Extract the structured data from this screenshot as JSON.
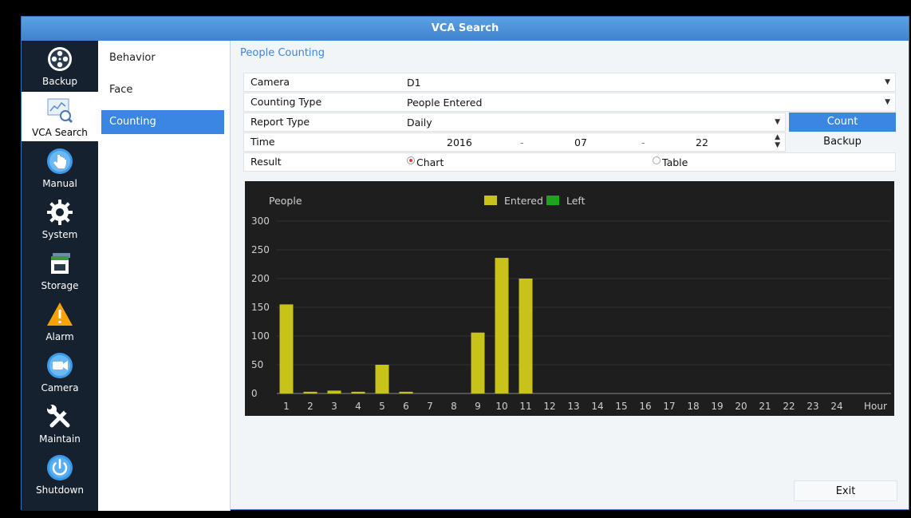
{
  "window": {
    "title": "VCA Search"
  },
  "nav": [
    {
      "id": "backup",
      "label": "Backup",
      "icon": "film-reel-icon"
    },
    {
      "id": "vca-search",
      "label": "VCA Search",
      "icon": "chart-magnifier-icon",
      "active": true
    },
    {
      "id": "manual",
      "label": "Manual",
      "icon": "hand-pointer-icon"
    },
    {
      "id": "system",
      "label": "System",
      "icon": "gear-icon"
    },
    {
      "id": "storage",
      "label": "Storage",
      "icon": "storage-icon"
    },
    {
      "id": "alarm",
      "label": "Alarm",
      "icon": "warning-icon"
    },
    {
      "id": "camera",
      "label": "Camera",
      "icon": "camera-icon"
    },
    {
      "id": "maintain",
      "label": "Maintain",
      "icon": "wrench-screwdriver-icon"
    },
    {
      "id": "shutdown",
      "label": "Shutdown",
      "icon": "power-icon"
    }
  ],
  "subnav": [
    {
      "label": "Behavior"
    },
    {
      "label": "Face"
    },
    {
      "label": "Counting",
      "active": true
    }
  ],
  "section_title": "People Counting",
  "form": {
    "camera_label": "Camera",
    "camera_value": "D1",
    "counting_type_label": "Counting Type",
    "counting_type_value": "People Entered",
    "report_type_label": "Report Type",
    "report_type_value": "Daily",
    "time_label": "Time",
    "time_year": "2016",
    "time_month": "07",
    "time_day": "22",
    "time_sep": "-",
    "result_label": "Result",
    "result_chart": "Chart",
    "result_table": "Table",
    "result_selected": "Chart"
  },
  "buttons": {
    "count": "Count",
    "backup": "Backup",
    "exit": "Exit"
  },
  "colors": {
    "accent": "#3a86e0",
    "entered": "#c8c21a",
    "left": "#1ea31e",
    "chart_bg": "#1e1e1e"
  },
  "chart_data": {
    "type": "bar",
    "ylabel": "People",
    "xlabel": "Hour",
    "ylim": [
      0,
      300
    ],
    "yticks": [
      0,
      50,
      100,
      150,
      200,
      250,
      300
    ],
    "categories": [
      "1",
      "2",
      "3",
      "4",
      "5",
      "6",
      "7",
      "8",
      "9",
      "10",
      "11",
      "12",
      "13",
      "14",
      "15",
      "16",
      "17",
      "18",
      "19",
      "20",
      "21",
      "22",
      "23",
      "24"
    ],
    "legend": [
      "Entered",
      "Left"
    ],
    "legend_position": "top-center",
    "grid": true,
    "series": [
      {
        "name": "Entered",
        "values": [
          155,
          3,
          5,
          3,
          50,
          3,
          0,
          0,
          106,
          236,
          200,
          0,
          0,
          0,
          0,
          0,
          0,
          0,
          0,
          0,
          0,
          0,
          0,
          0
        ]
      }
    ]
  }
}
